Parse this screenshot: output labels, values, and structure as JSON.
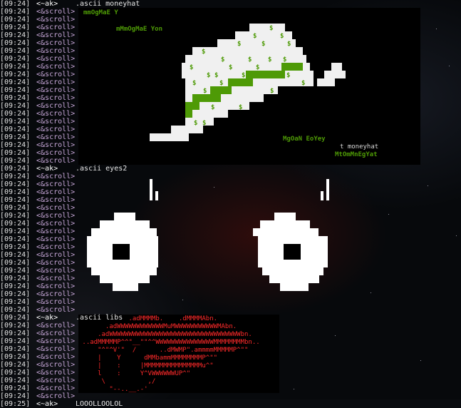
{
  "colors": {
    "accent_green": "#4e9a06",
    "nick": "#c7a7d8",
    "libs_red": "#ff2a2a"
  },
  "moneyhat": {
    "text_1": "mmOgMaE Y",
    "text_2": "mMmOgMaE Yon",
    "text_3": "MgOaN EoYey",
    "text_4": "t moneyhat",
    "text_5": "MtOmMnEgYat",
    "dollar": "$"
  },
  "libs_art": [
    "             .adMMMMb.    .dMMMMAbn.",
    "       .adWWWWWWWWWWWWMuMWWWWWWWWWWWMAbn.",
    "     .adWWWWWWWWWWWWWWWWWWWWWWWWWWWWWWWWWWbn.",
    " ..adMMMMMP^^\"__\"\"^^WWWWWWWWWWWWWWWMMMMMMMMbn..",
    "     \"^\"^V'\"  /      ..dMWMP\".ammmmMMMMMP^\"\"",
    "     |    Y      dMMbammMMMMMMMMP^\"\"",
    "     |    :     |MMMMMMMMMMMMMMMu^\"",
    "     l    :     Y^VWWWWWWUP^\"",
    "      \\           ,/",
    "        \"--..__.-'"
  ],
  "lines": [
    {
      "ts": "[09:24]",
      "nick": " <~ak>",
      "msg": " .ascii moneyhat",
      "cmd": true
    },
    {
      "ts": "[09:24]",
      "nick": " <&scroll>",
      "msg": ""
    },
    {
      "ts": "[09:24]",
      "nick": " <&scroll>",
      "msg": ""
    },
    {
      "ts": "[09:24]",
      "nick": " <&scroll>",
      "msg": ""
    },
    {
      "ts": "[09:24]",
      "nick": " <&scroll>",
      "msg": ""
    },
    {
      "ts": "[09:24]",
      "nick": " <&scroll>",
      "msg": ""
    },
    {
      "ts": "[09:24]",
      "nick": " <&scroll>",
      "msg": ""
    },
    {
      "ts": "[09:24]",
      "nick": " <&scroll>",
      "msg": ""
    },
    {
      "ts": "[09:24]",
      "nick": " <&scroll>",
      "msg": ""
    },
    {
      "ts": "[09:24]",
      "nick": " <&scroll>",
      "msg": ""
    },
    {
      "ts": "[09:24]",
      "nick": " <&scroll>",
      "msg": ""
    },
    {
      "ts": "[09:24]",
      "nick": " <&scroll>",
      "msg": ""
    },
    {
      "ts": "[09:24]",
      "nick": " <&scroll>",
      "msg": ""
    },
    {
      "ts": "[09:24]",
      "nick": " <&scroll>",
      "msg": ""
    },
    {
      "ts": "[09:24]",
      "nick": " <&scroll>",
      "msg": ""
    },
    {
      "ts": "[09:24]",
      "nick": " <&scroll>",
      "msg": ""
    },
    {
      "ts": "[09:24]",
      "nick": " <&scroll>",
      "msg": ""
    },
    {
      "ts": "[09:24]",
      "nick": " <&scroll>",
      "msg": ""
    },
    {
      "ts": "[09:24]",
      "nick": " <&scroll>",
      "msg": ""
    },
    {
      "ts": "[09:24]",
      "nick": " <&scroll>",
      "msg": ""
    },
    {
      "ts": "[09:24]",
      "nick": " <&scroll>",
      "msg": ""
    },
    {
      "ts": "[09:24]",
      "nick": " <~ak>",
      "msg": " .ascii eyes2",
      "cmd": true
    },
    {
      "ts": "[09:24]",
      "nick": " <&scroll>",
      "msg": ""
    },
    {
      "ts": "[09:24]",
      "nick": " <&scroll>",
      "msg": ""
    },
    {
      "ts": "[09:24]",
      "nick": " <&scroll>",
      "msg": ""
    },
    {
      "ts": "[09:24]",
      "nick": " <&scroll>",
      "msg": ""
    },
    {
      "ts": "[09:24]",
      "nick": " <&scroll>",
      "msg": ""
    },
    {
      "ts": "[09:24]",
      "nick": " <&scroll>",
      "msg": ""
    },
    {
      "ts": "[09:24]",
      "nick": " <&scroll>",
      "msg": ""
    },
    {
      "ts": "[09:24]",
      "nick": " <&scroll>",
      "msg": ""
    },
    {
      "ts": "[09:24]",
      "nick": " <&scroll>",
      "msg": ""
    },
    {
      "ts": "[09:24]",
      "nick": " <&scroll>",
      "msg": ""
    },
    {
      "ts": "[09:24]",
      "nick": " <&scroll>",
      "msg": ""
    },
    {
      "ts": "[09:24]",
      "nick": " <&scroll>",
      "msg": ""
    },
    {
      "ts": "[09:24]",
      "nick": " <&scroll>",
      "msg": ""
    },
    {
      "ts": "[09:24]",
      "nick": " <&scroll>",
      "msg": ""
    },
    {
      "ts": "[09:24]",
      "nick": " <&scroll>",
      "msg": ""
    },
    {
      "ts": "[09:24]",
      "nick": " <&scroll>",
      "msg": ""
    },
    {
      "ts": "[09:24]",
      "nick": " <&scroll>",
      "msg": ""
    },
    {
      "ts": "[09:24]",
      "nick": " <&scroll>",
      "msg": ""
    },
    {
      "ts": "[09:24]",
      "nick": " <~ak>",
      "msg": " .ascii libs",
      "cmd": true
    },
    {
      "ts": "[09:24]",
      "nick": " <&scroll>",
      "msg": ""
    },
    {
      "ts": "[09:24]",
      "nick": " <&scroll>",
      "msg": ""
    },
    {
      "ts": "[09:24]",
      "nick": " <&scroll>",
      "msg": ""
    },
    {
      "ts": "[09:24]",
      "nick": " <&scroll>",
      "msg": ""
    },
    {
      "ts": "[09:24]",
      "nick": " <&scroll>",
      "msg": ""
    },
    {
      "ts": "[09:24]",
      "nick": " <&scroll>",
      "msg": ""
    },
    {
      "ts": "[09:24]",
      "nick": " <&scroll>",
      "msg": ""
    },
    {
      "ts": "[09:24]",
      "nick": " <&scroll>",
      "msg": ""
    },
    {
      "ts": "[09:24]",
      "nick": " <&scroll>",
      "msg": ""
    },
    {
      "ts": "[09:24]",
      "nick": " <&scroll>",
      "msg": ""
    },
    {
      "ts": "[09:25]",
      "nick": " <~ak>",
      "msg": " LOOOLLOOLOL",
      "cmd": true
    }
  ]
}
